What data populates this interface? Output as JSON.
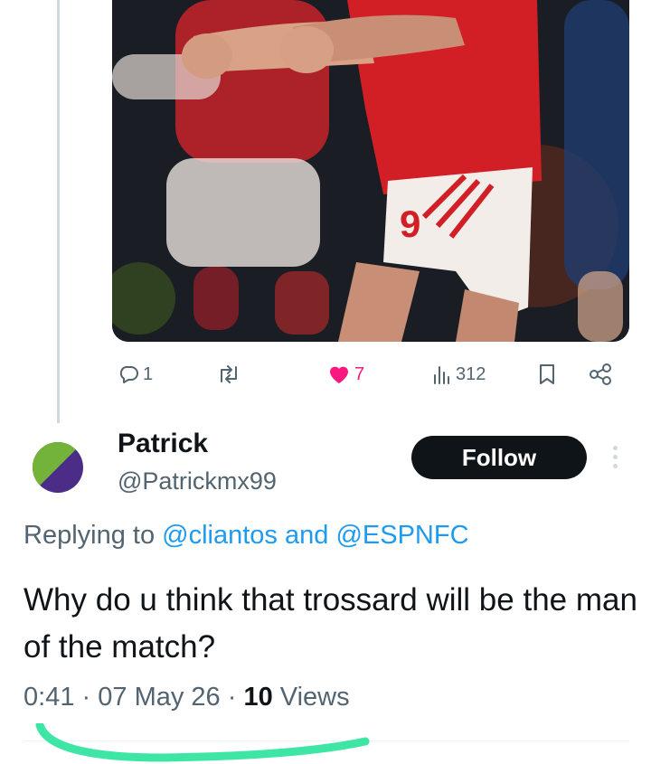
{
  "parent_tweet": {
    "media_alt": "Player in red kit with number 9 celebrating with fists clenched",
    "actions": {
      "replies": "1",
      "likes": "7",
      "views": "312"
    }
  },
  "reply": {
    "author": {
      "name": "Patrick",
      "handle": "@Patrickmx99"
    },
    "follow_label": "Follow",
    "replying_prefix": "Replying to",
    "mention_1": "@cliantos",
    "and_word": "and",
    "mention_2": "@ESPNFC",
    "text": "Why do u think that trossard will be the man of the match?",
    "time": "0:41",
    "date": "07 May 26",
    "views_count": "10",
    "views_label": "Views"
  },
  "colors": {
    "accent": "#1d9bf0",
    "like": "#f91880",
    "muted": "#536471",
    "highlight": "#3ee6a6"
  },
  "icons": [
    "reply-icon",
    "retweet-icon",
    "heart-icon",
    "views-icon",
    "bookmark-icon",
    "share-icon",
    "more-icon"
  ]
}
